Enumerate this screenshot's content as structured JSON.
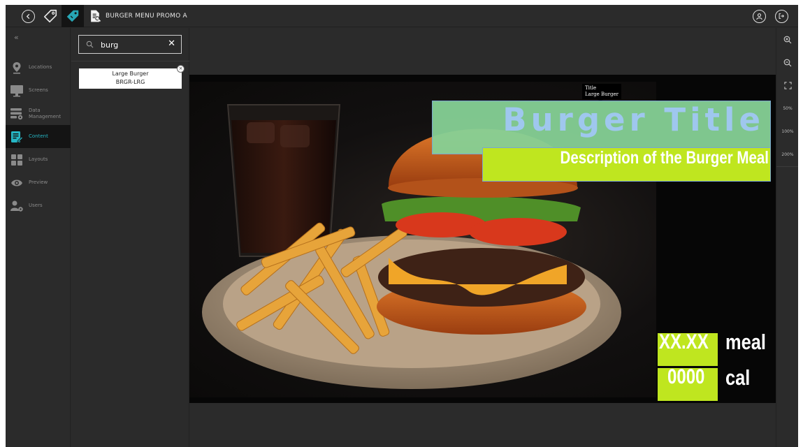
{
  "app": {
    "document_title": "BURGER MENU PROMO A",
    "colors": {
      "accent": "#26b6c4",
      "highlight": "#bfe61f",
      "title_fill": "#86d196"
    }
  },
  "topbar": {
    "icons": [
      "back-icon",
      "tag-icon",
      "tag-active-icon",
      "document-search-icon"
    ],
    "right_icons": [
      "user-icon",
      "logout-icon"
    ]
  },
  "nav": {
    "collapse": "«",
    "items": [
      {
        "label": "Locations",
        "icon": "location-pin-icon"
      },
      {
        "label": "Screens",
        "icon": "monitor-icon"
      },
      {
        "label": "Data Management",
        "icon": "database-gear-icon"
      },
      {
        "label": "Content",
        "icon": "content-edit-icon",
        "active": true
      },
      {
        "label": "Layouts",
        "icon": "layouts-icon"
      },
      {
        "label": "Preview",
        "icon": "eye-icon"
      },
      {
        "label": "Users",
        "icon": "users-gear-icon"
      }
    ]
  },
  "search": {
    "value": "burg",
    "clear": "✕",
    "results": [
      {
        "name": "Large Burger",
        "code": "BRGR-LRG",
        "remove": "×"
      }
    ]
  },
  "zoom": {
    "tools": [
      "zoom-in-icon",
      "zoom-out-icon",
      "fit-screen-icon"
    ],
    "presets": [
      "50%",
      "100%",
      "200%"
    ]
  },
  "canvas": {
    "tooltip": {
      "field": "Title",
      "value": "Large Burger"
    },
    "title": "Burger Title",
    "description": "Description of the Burger Meal",
    "price_value": "XX.XX",
    "price_unit": "meal",
    "calorie_value": "0000",
    "calorie_unit": "cal"
  }
}
